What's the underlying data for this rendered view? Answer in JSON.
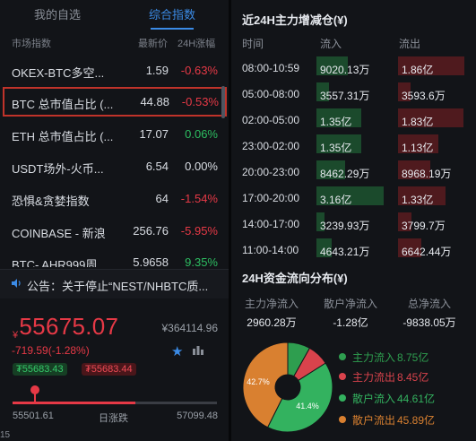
{
  "tabs": [
    {
      "label": "我的自选"
    },
    {
      "label": "综合指数"
    }
  ],
  "list_header": {
    "market": "市场指数",
    "price": "最新价",
    "change": "24H涨幅"
  },
  "list": [
    {
      "name": "OKEX-BTC多空...",
      "price": "1.59",
      "change": "-0.63%",
      "dir": "neg"
    },
    {
      "name": "BTC 总市值占比 (...",
      "price": "44.88",
      "change": "-0.53%",
      "dir": "neg"
    },
    {
      "name": "ETH 总市值占比 (...",
      "price": "17.07",
      "change": "0.06%",
      "dir": "pos"
    },
    {
      "name": "USDT场外-火币...",
      "price": "6.54",
      "change": "0.00%",
      "dir": "neu"
    },
    {
      "name": "恐惧&贪婪指数",
      "price": "64",
      "change": "-1.54%",
      "dir": "neg"
    },
    {
      "name": "COINBASE - 新浪",
      "price": "256.76",
      "change": "-5.95%",
      "dir": "neg"
    },
    {
      "name": "BTC- AHR999周...",
      "price": "5.9658",
      "change": "9.35%",
      "dir": "pos"
    }
  ],
  "notice": {
    "text": "公告：关于停止“NEST/NHBTC质..."
  },
  "ticker": {
    "currency": "¥",
    "price": "55675.07",
    "secondary": "¥364114.96",
    "change": "-719.59(-1.28%)",
    "bid": "₮55683.43",
    "ask": "₮55683.44",
    "range_low": "55501.61",
    "range_label": "日涨跌",
    "range_high": "57099.48",
    "range_position": 0.6,
    "corner": "15"
  },
  "flow": {
    "title": "近24H主力增减仓(¥)",
    "col_time": "时间",
    "col_in": "流入",
    "col_out": "流出",
    "rows": [
      {
        "time": "08:00-10:59",
        "inflow": "9020.13万",
        "outflow": "1.86亿",
        "in_level": 0.46,
        "out_level": 0.92
      },
      {
        "time": "05:00-08:00",
        "inflow": "3557.31万",
        "outflow": "3593.6万",
        "in_level": 0.18,
        "out_level": 0.18
      },
      {
        "time": "02:00-05:00",
        "inflow": "1.35亿",
        "outflow": "1.83亿",
        "in_level": 0.66,
        "out_level": 0.91
      },
      {
        "time": "23:00-02:00",
        "inflow": "1.35亿",
        "outflow": "1.13亿",
        "in_level": 0.66,
        "out_level": 0.56
      },
      {
        "time": "20:00-23:00",
        "inflow": "8462.29万",
        "outflow": "8968.19万",
        "in_level": 0.43,
        "out_level": 0.45
      },
      {
        "time": "17:00-20:00",
        "inflow": "3.16亿",
        "outflow": "1.33亿",
        "in_level": 1.0,
        "out_level": 0.66
      },
      {
        "time": "14:00-17:00",
        "inflow": "3239.93万",
        "outflow": "3799.7万",
        "in_level": 0.12,
        "out_level": 0.19
      },
      {
        "time": "11:00-14:00",
        "inflow": "4643.21万",
        "outflow": "6642.44万",
        "in_level": 0.22,
        "out_level": 0.33
      }
    ]
  },
  "distribution": {
    "title": "24H资金流向分布(¥)",
    "net": [
      {
        "label": "主力净流入",
        "value": "2960.28万"
      },
      {
        "label": "散户净流入",
        "value": "-1.28亿"
      },
      {
        "label": "总净流入",
        "value": "-9838.05万"
      }
    ],
    "legend": [
      {
        "label": "主力流入",
        "value": "8.75亿",
        "color": "#2e9e4f"
      },
      {
        "label": "主力流出",
        "value": "8.45亿",
        "color": "#d9434c"
      },
      {
        "label": "散户流入",
        "value": "44.61亿",
        "color": "#33b25f"
      },
      {
        "label": "散户流出",
        "value": "45.89亿",
        "color": "#d98030"
      }
    ],
    "pie_labels": [
      {
        "text": "42.7%"
      },
      {
        "text": "41.4%"
      }
    ],
    "pie_values": [
      8.75,
      8.45,
      44.61,
      45.89
    ],
    "colors": {
      "in": "#2e9e4f",
      "out": "#d9434c",
      "retail_in": "#33b25f",
      "retail_out": "#d98030"
    }
  }
}
